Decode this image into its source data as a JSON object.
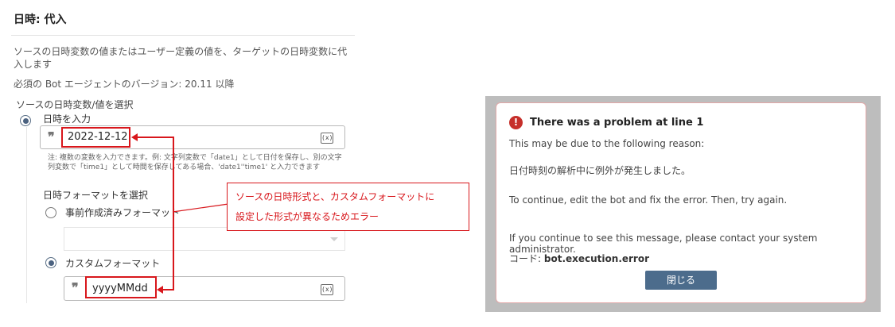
{
  "page": {
    "title": "日時: 代入",
    "description": "ソースの日時変数の値またはユーザー定義の値を、ターゲットの日時変数に代入します",
    "required_version": "必須の Bot エージェントのバージョン: 20.11 以降",
    "source_label": "ソースの日時変数/値を選択"
  },
  "source": {
    "option_label": "日時を入力",
    "input_value": "2022-12-12",
    "quote_icon": "quote-icon",
    "variable_icon": "(x)",
    "note": "注: 複数の変数を入力できます。例: 文字列変数で「date1」として日付を保存し、別の文字列変数で「time1」として時間を保存してある場合、'date1''time1' と入力できます"
  },
  "format": {
    "section_label": "日時フォーマットを選択",
    "predefined_label": "事前作成済みフォーマット",
    "predefined_value": "",
    "custom_label": "カスタムフォーマット",
    "custom_value": "yyyyMMdd",
    "variable_icon": "(x)"
  },
  "callout": {
    "line1": "ソースの日時形式と、カスタムフォーマットに",
    "line2": "設定した形式が異なるためエラー"
  },
  "dialog": {
    "icon": "!",
    "title": "There was a problem at line 1",
    "reason": "This may be due to the following reason:",
    "error_message": "日付時刻の解析中に例外が発生しました。",
    "instruction": "To continue, edit the bot and fix the error. Then, try again.",
    "contact": "If you continue to see this message, please contact your system administrator.",
    "code_label": "コード:",
    "code_value": "bot.execution.error",
    "close_label": "閉じる"
  },
  "colors": {
    "accent_red": "#d8171c",
    "button": "#4c6c8c",
    "error_icon": "#c62f2a"
  }
}
